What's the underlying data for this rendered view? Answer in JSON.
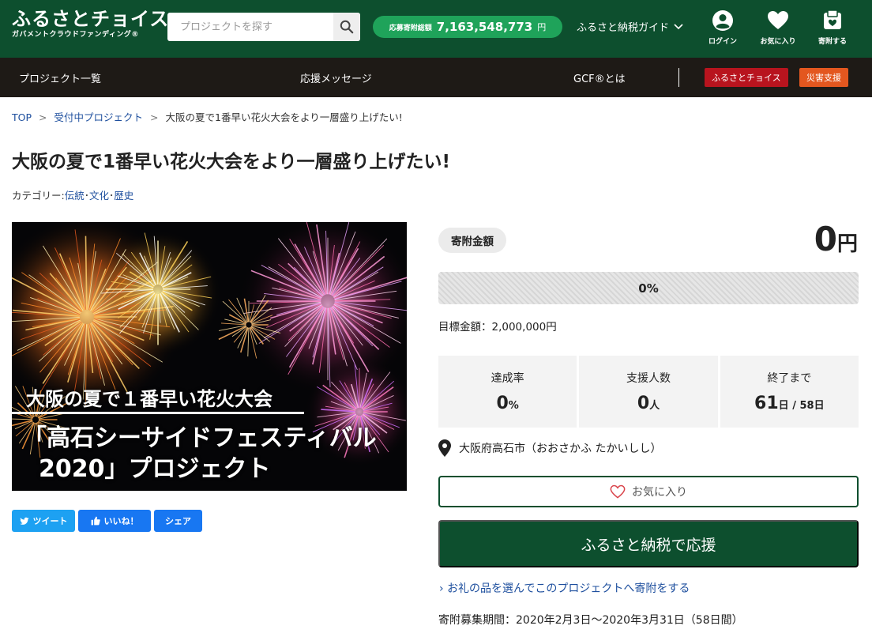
{
  "header": {
    "logo_main": "ふるさとチョイス",
    "logo_sub": "ガバメントクラウドファンディング®",
    "search_placeholder": "プロジェクトを探す",
    "donation_label": "応募寄附総額",
    "donation_amount": "7,163,548,773",
    "donation_unit": "円",
    "guide_label": "ふるさと納税ガイド",
    "login_label": "ログイン",
    "favorites_label": "お気に入り",
    "donate_label": "寄附する"
  },
  "nav": {
    "projects": "プロジェクト一覧",
    "messages": "応援メッセージ",
    "gcf": "GCF®とは",
    "choice_badge": "ふるさとチョイス",
    "disaster_badge": "災害支援"
  },
  "breadcrumb": {
    "top": "TOP",
    "sep1": ">",
    "accepting": "受付中プロジェクト",
    "sep2": ">",
    "current": "大阪の夏で1番早い花火大会をより一層盛り上げたい!"
  },
  "page": {
    "title": "大阪の夏で1番早い花火大会をより一層盛り上げたい!",
    "category_label": "カテゴリー:",
    "category_items": [
      "伝統",
      "文化",
      "歴史"
    ],
    "category_sep": "･"
  },
  "hero": {
    "line1": "大阪の夏で１番早い花火大会",
    "line2": "「高石シーサイドフェスティバル",
    "line3": "2020」プロジェクト"
  },
  "share": {
    "tweet": "ツイート",
    "like": "いいね！",
    "share": "シェア"
  },
  "funding": {
    "amount_label": "寄附金額",
    "amount_value": "0",
    "amount_unit": "円",
    "progress_percent": 0,
    "progress_text": "0%",
    "goal_label": "目標金額：",
    "goal_value": "2,000,000円",
    "stats": {
      "rate_label": "達成率",
      "rate_value": "0",
      "rate_unit": "%",
      "supporters_label": "支援人数",
      "supporters_value": "0",
      "supporters_unit": "人",
      "remaining_label": "終了まで",
      "remaining_value": "61",
      "remaining_unit": "日",
      "remaining_total": " / 58日"
    },
    "location": "大阪府高石市（おおさかふ たかいしし）",
    "favorite_button": "お気に入り",
    "support_button": "ふるさと納税で応援",
    "gift_link": "お礼の品を選んでこのプロジェクトへ寄附をする",
    "period_label": "寄附募集期間：",
    "period_value": "2020年2月3日～2020年3月31日（58日間）"
  },
  "colors": {
    "header_bg": "#0d4f2e",
    "nav_bg": "#1e1a16",
    "accent_green": "#1fa35a",
    "choice_badge": "#b8141e",
    "disaster_badge": "#e3571f",
    "twitter": "#1da1f2",
    "facebook": "#1877f2",
    "link": "#1e4f9e"
  },
  "icons": {
    "search": "search-icon",
    "chevron": "chevron-down-icon",
    "user": "user-icon",
    "heart": "heart-icon",
    "donate": "donate-box-icon",
    "location": "map-pin-icon",
    "twitter": "twitter-bird-icon",
    "like": "thumbs-up-icon"
  }
}
